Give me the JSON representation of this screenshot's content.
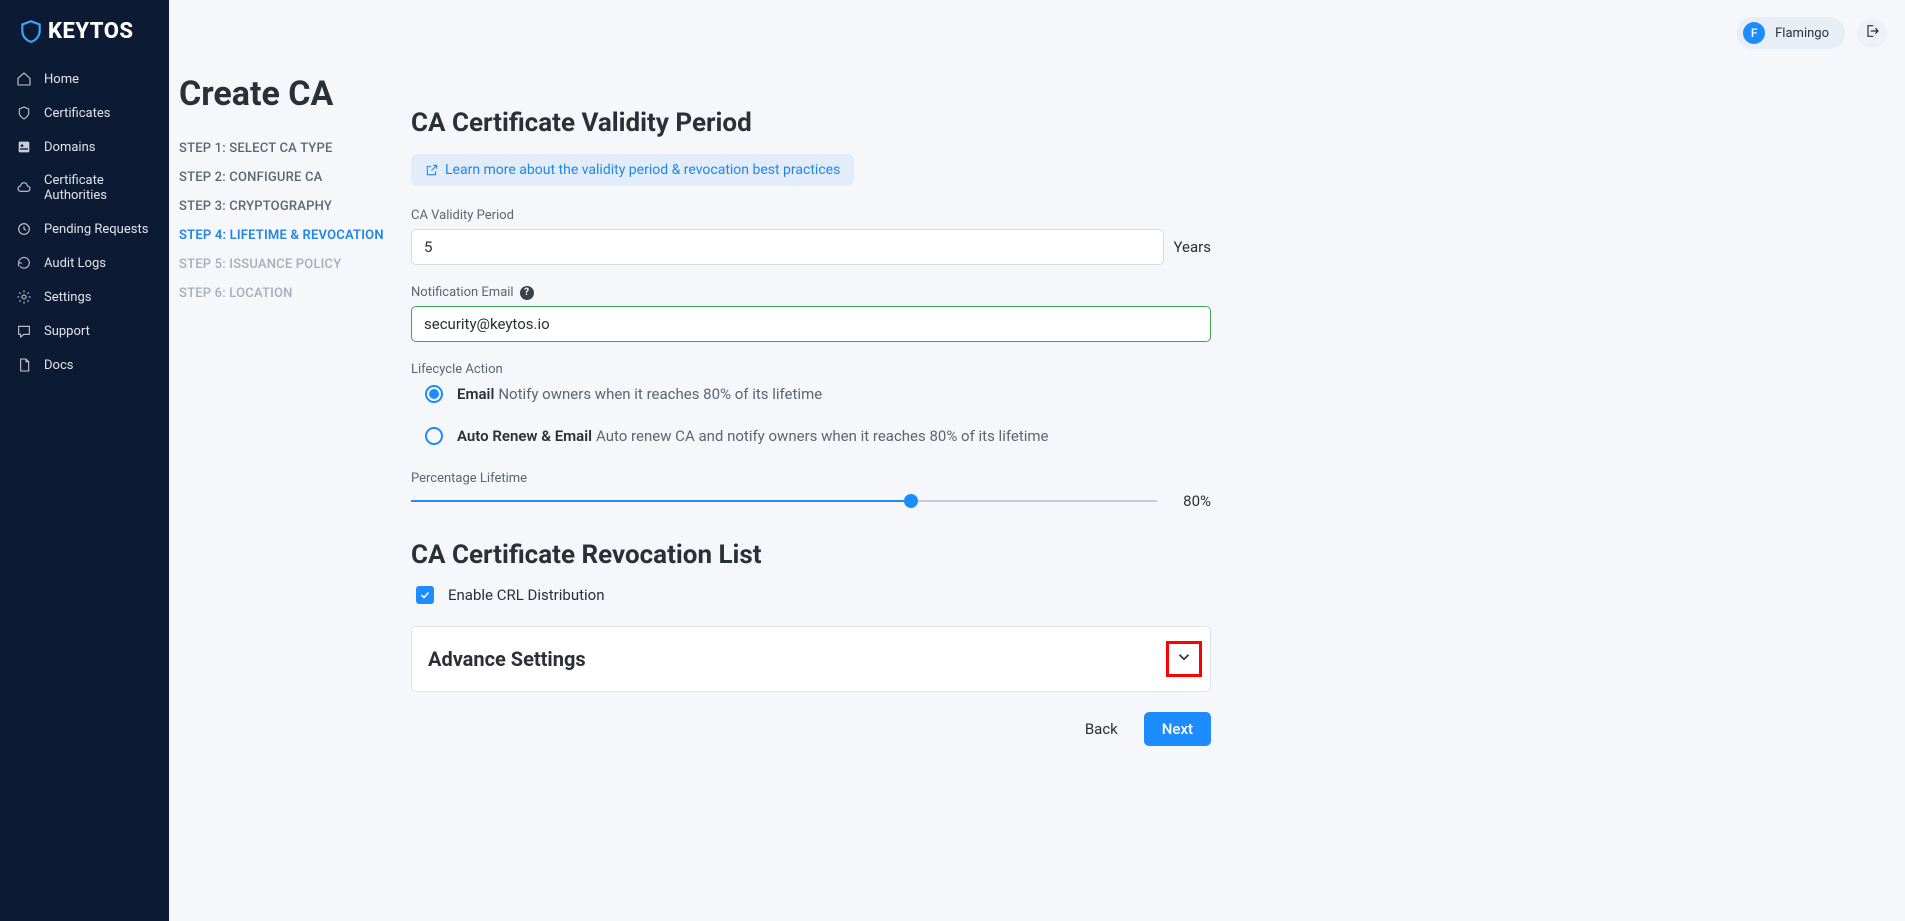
{
  "brand": {
    "name": "KEYTOS",
    "initial_color": "#3aa6ff"
  },
  "nav": {
    "home": "Home",
    "certificates": "Certificates",
    "domains": "Domains",
    "cas": "Certificate Authorities",
    "pending": "Pending Requests",
    "audit": "Audit Logs",
    "settings": "Settings",
    "support": "Support",
    "docs": "Docs"
  },
  "topbar": {
    "user_initial": "F",
    "user_name": "Flamingo"
  },
  "page": {
    "title": "Create CA"
  },
  "steps": {
    "s1": "STEP 1: SELECT CA TYPE",
    "s2": "STEP 2: CONFIGURE CA",
    "s3": "STEP 3: CRYPTOGRAPHY",
    "s4": "STEP 4: LIFETIME & REVOCATION",
    "s5": "STEP 5: ISSUANCE POLICY",
    "s6": "STEP 6: LOCATION"
  },
  "form": {
    "section1_title": "CA Certificate Validity Period",
    "learn_more": "Learn more about the validity period & revocation best practices",
    "validity_label": "CA Validity Period",
    "validity_value": "5",
    "validity_unit": "Years",
    "notif_label": "Notification Email",
    "notif_value": "security@keytos.io",
    "lifecycle_label": "Lifecycle Action",
    "radio": {
      "email_strong": "Email",
      "email_desc": "Notify owners when it reaches 80% of its lifetime",
      "auto_strong": "Auto Renew & Email",
      "auto_desc": "Auto renew CA and notify owners when it reaches 80% of its lifetime"
    },
    "pct_label": "Percentage Lifetime",
    "pct_value": "80%",
    "section2_title": "CA Certificate Revocation List",
    "crl_checkbox": "Enable CRL Distribution",
    "accordion_title": "Advance Settings",
    "back": "Back",
    "next": "Next"
  }
}
